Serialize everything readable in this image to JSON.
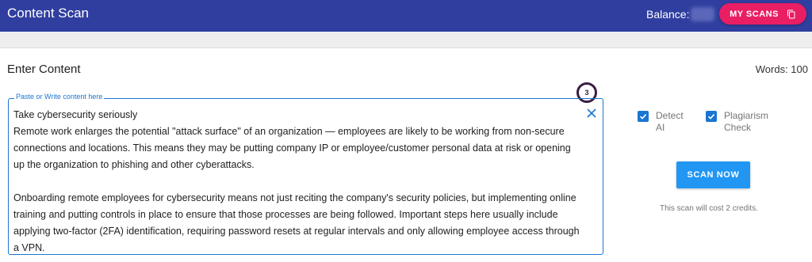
{
  "appbar": {
    "title": "Content Scan",
    "balance_label": "Balance:",
    "my_scans_label": "MY SCANS"
  },
  "main": {
    "heading": "Enter Content",
    "words": "Words: 100",
    "badge": "3",
    "field": {
      "label": "Paste or Write content here",
      "value": "Take cybersecurity seriously\nRemote work enlarges the potential \"attack surface\" of an organization — employees are likely to be working from non-secure connections and locations. This means they may be putting company IP or employee/customer personal data at risk or opening up the organization to phishing and other cyberattacks.\n\nOnboarding remote employees for cybersecurity means not just reciting the company's security policies, but implementing online training and putting controls in place to ensure that those processes are being followed. Important steps here usually include applying two-factor (2FA) identification, requiring password resets at regular intervals and only allowing employee access through a VPN."
    }
  },
  "options": {
    "detect_ai": {
      "label": "Detect AI",
      "checked": true
    },
    "plagiarism": {
      "label": "Plagiarism Check",
      "checked": true
    }
  },
  "scan": {
    "button_label": "SCAN NOW",
    "cost_note": "This scan will cost 2 credits."
  },
  "colors": {
    "appbar": "#303f9f",
    "accent_pink": "#e91e63",
    "primary_blue": "#1976d2",
    "button_blue": "#2196f3"
  },
  "icons": {
    "copy": "copy-icon",
    "clear": "close-icon",
    "checkbox": "checkbox-checked-icon"
  }
}
